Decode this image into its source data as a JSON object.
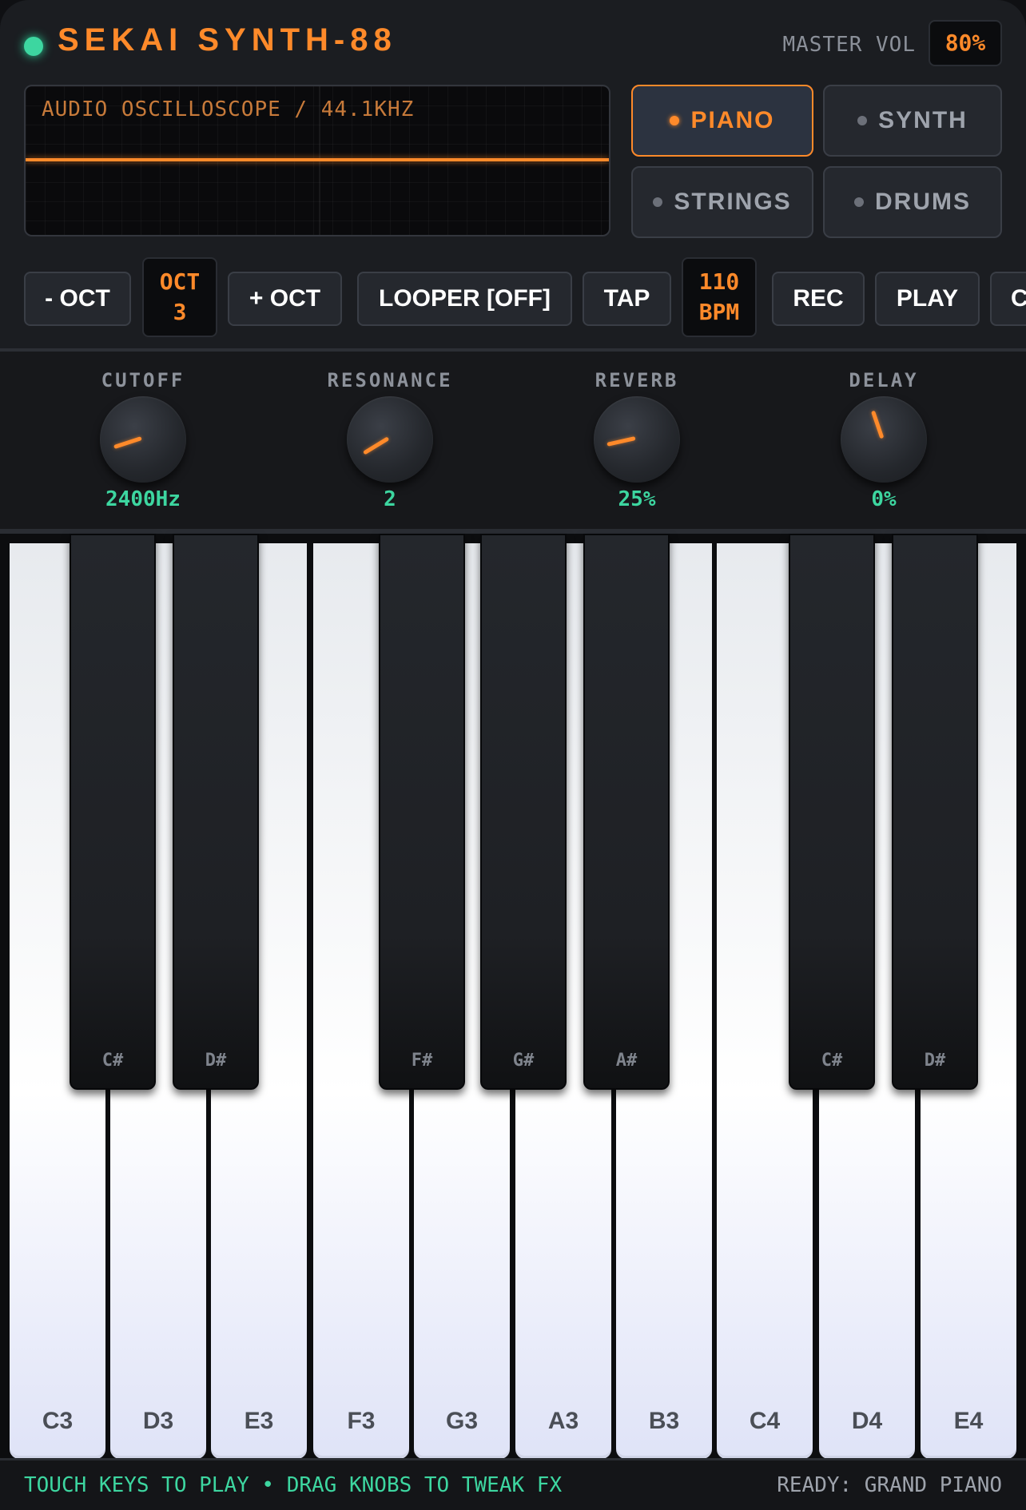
{
  "header": {
    "title": "SEKAI SYNTH-88",
    "master_vol_label": "MASTER VOL",
    "master_vol_value": "80%"
  },
  "scope": {
    "label": "AUDIO OSCILLOSCOPE / 44.1KHZ"
  },
  "instruments": [
    {
      "label": "PIANO",
      "active": true
    },
    {
      "label": "SYNTH",
      "active": false
    },
    {
      "label": "STRINGS",
      "active": false
    },
    {
      "label": "DRUMS",
      "active": false
    }
  ],
  "controls": {
    "oct_down": "- OCT",
    "oct_readout_line1": "OCT",
    "oct_readout_line2": "3",
    "oct_up": "+ OCT",
    "looper": "LOOPER [OFF]",
    "tap": "TAP",
    "bpm_readout_line1": "110",
    "bpm_readout_line2": "BPM",
    "rec": "REC",
    "play": "PLAY",
    "clipped": "C"
  },
  "fx": [
    {
      "label": "CUTOFF",
      "value": "2400Hz",
      "level": 0.1
    },
    {
      "label": "RESONANCE",
      "value": "2",
      "level": 0.05
    },
    {
      "label": "REVERB",
      "value": "25%",
      "level": 0.12
    },
    {
      "label": "DELAY",
      "value": "0%",
      "level": 0.43
    }
  ],
  "keyboard": {
    "white_keys": [
      "C3",
      "D3",
      "E3",
      "F3",
      "G3",
      "A3",
      "B3",
      "C4",
      "D4",
      "E4"
    ],
    "black_keys": [
      "C#",
      "D#",
      "F#",
      "G#",
      "A#",
      "C#",
      "D#"
    ]
  },
  "footer": {
    "hint": "TOUCH KEYS TO PLAY • DRAG KNOBS TO TWEAK FX",
    "status": "READY: GRAND PIANO"
  },
  "colors": {
    "accent": "#ff8a2a",
    "led": "#3dd6a0",
    "value_text": "#3dd6a0"
  }
}
